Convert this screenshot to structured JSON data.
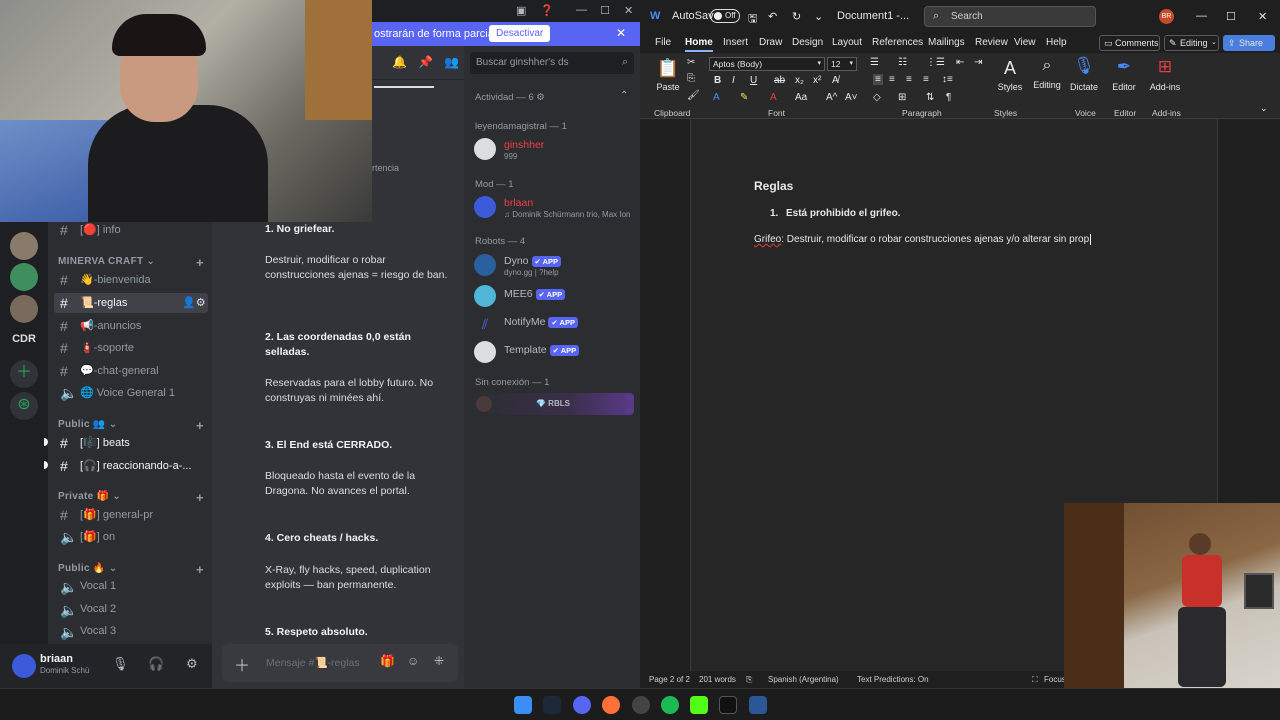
{
  "discord": {
    "banner": {
      "text": "ostrarán de forma parcial.",
      "button": "Desactivar"
    },
    "server_cdr": "CDR",
    "categories": {
      "minerva": "MINERVA CRAFT",
      "public": "Public 👥",
      "private": "Private 🎁",
      "public2": "Public 🔥"
    },
    "channels": {
      "info": "[🔴] info",
      "bienvenida": "👋-bienvenida",
      "reglas": "📜-reglas",
      "anuncios": "📢-anuncios",
      "soporte": "🧯-soporte",
      "chat_general": "💬-chat-general",
      "voice_general": "🌐 Voice General 1",
      "beats": "[🎼] beats",
      "reaccionando": "[🎧] reaccionando-a-...",
      "general_pr": "[🎁] general-pr",
      "on": "[🎁] on",
      "vocal1": "Vocal 1",
      "vocal2": "Vocal 2",
      "vocal3": "Vocal 3"
    },
    "user": {
      "name": "briaan",
      "status": "Dominik Schü"
    },
    "chat": {
      "fragment": "rtencia",
      "messages": [
        {
          "text": "1. No griefear.",
          "bold": true
        },
        {
          "text": "Destruir, modificar o robar construcciones ajenas = riesgo de ban.",
          "bold": false
        },
        {
          "text": "2. Las coordenadas 0,0 están selladas.",
          "bold": true
        },
        {
          "text": "Reservadas para el lobby futuro. No construyas ni minées ahí.",
          "bold": false
        },
        {
          "text": "3. El End está CERRADO.",
          "bold": true
        },
        {
          "text": "Bloqueado hasta el evento de la Dragona. No avances el portal.",
          "bold": false
        },
        {
          "text": "4. Cero cheats / hacks.",
          "bold": true
        },
        {
          "text": "X-Ray, fly hacks, speed, duplication exploits — ban permanente.",
          "bold": false
        },
        {
          "text": "5. Respeto absoluto.",
          "bold": true
        }
      ],
      "placeholder": "Mensaje #📜-reglas"
    },
    "members": {
      "search": "Buscar ginshher's ds",
      "activity": "Actividad — 6 ⚙",
      "groups": [
        {
          "header": "leyendamagistral — 1",
          "name": "ginshher",
          "sub": "999",
          "name_color": "#f23f43",
          "avatar": "#dbdee1",
          "app": false
        },
        {
          "header": "Mod — 1",
          "name": "brlaan",
          "sub": "♫ Dominik Schürmann trio, Max Ion",
          "name_color": "#f23f43",
          "avatar": "#3b5bdb",
          "app": false
        }
      ],
      "robots_header": "Robots — 4",
      "robots": [
        {
          "name": "Dyno",
          "sub": "dyno.gg | ?help",
          "app": "✔ APP",
          "avatar": "#2a5fa0"
        },
        {
          "name": "MEE6",
          "sub": "",
          "app": "✔ APP",
          "avatar": "#4fb6d8"
        },
        {
          "name": "NotifyMe",
          "sub": "",
          "app": "✔ APP",
          "avatar": "#2b2d31"
        },
        {
          "name": "Template",
          "sub": "",
          "app": "✔ APP",
          "avatar": "#dbdee1"
        }
      ],
      "offline_header": "Sin conexión — 1",
      "offline_tag": "💎 RBLS"
    }
  },
  "word": {
    "autosave": "AutoSave",
    "toggle": "Off",
    "doc_name": "Document1  -...",
    "search": "Search",
    "user_initials": "BR",
    "tabs": [
      "File",
      "Home",
      "Insert",
      "Draw",
      "Design",
      "Layout",
      "References",
      "Mailings",
      "Review",
      "View",
      "Help"
    ],
    "comments": "Comments",
    "editing": "Editing",
    "share": "Share",
    "ribbon": {
      "paste": "Paste",
      "font": "Aptos (Body)",
      "size": "12",
      "groups": [
        "Clipboard",
        "Font",
        "Paragraph",
        "Styles",
        "Voice",
        "Editor",
        "Add-ins"
      ],
      "styles": "Styles",
      "editing": "Editing",
      "dictate": "Dictate",
      "editor": "Editor",
      "addins": "Add-ins"
    },
    "doc": {
      "heading": "Reglas",
      "list_num": "1.",
      "list_item": "Está prohibido el grifeo.",
      "para_label": "Grifeo",
      "para_rest": ": Destruir, modificar o robar construcciones ajenas y/o alterar sin prop"
    },
    "status": {
      "page": "Page 2 of 2",
      "words": "201 words",
      "language": "Spanish (Argentina)",
      "predictions": "Text Predictions: On",
      "focus": "Focus"
    }
  }
}
